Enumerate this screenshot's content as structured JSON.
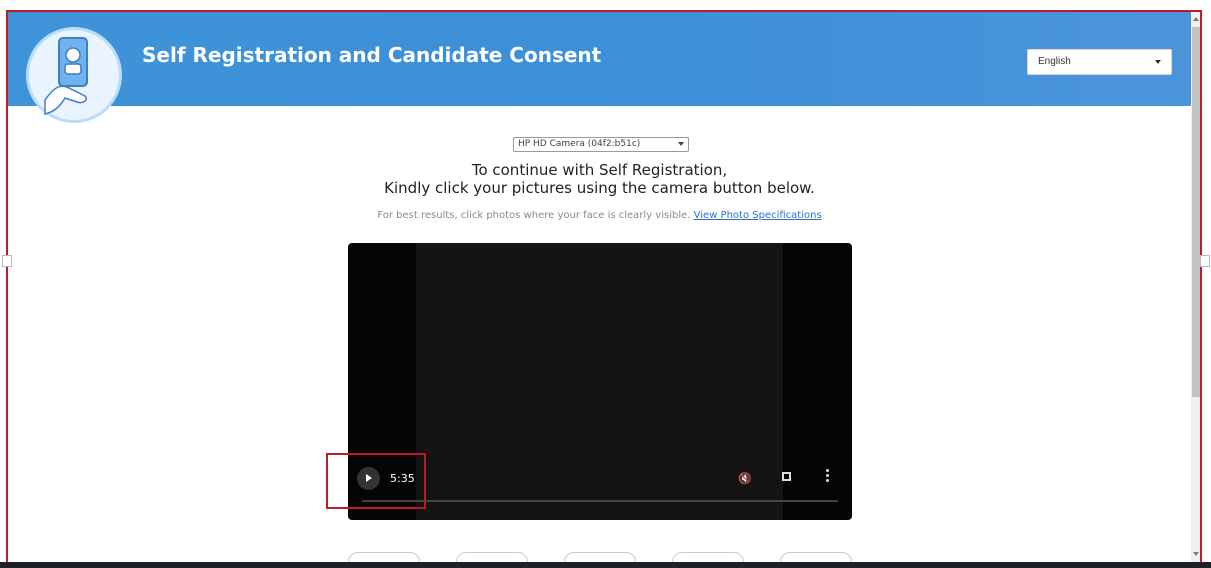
{
  "header": {
    "title": "Self Registration and Candidate Consent"
  },
  "language": {
    "selected": "English"
  },
  "camera": {
    "selected": "HP HD Camera (04f2:b51c)"
  },
  "instructions": {
    "line1": "To continue with Self Registration,",
    "line2": "Kindly click your pictures using the camera button below.",
    "hint_text": "For best results, click photos where your face is clearly visible.",
    "hint_link": "View Photo Specifications"
  },
  "video": {
    "time": "5:35"
  },
  "icons": {
    "logo": "person-phone-icon",
    "play": "play-icon",
    "mute": "volume-muted-icon",
    "fullscreen": "fullscreen-icon",
    "more": "more-vertical-icon",
    "dropdown": "chevron-down-icon"
  },
  "colors": {
    "header_blue": "#3f93d8",
    "highlight_red": "#b81f24",
    "link_blue": "#2f6fcf",
    "video_black": "#050505"
  }
}
